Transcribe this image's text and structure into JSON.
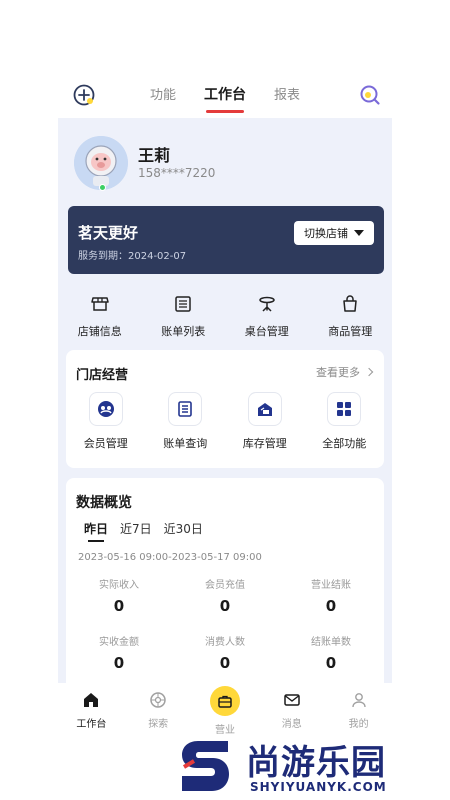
{
  "header": {
    "tabs": [
      {
        "label": "功能"
      },
      {
        "label": "工作台"
      },
      {
        "label": "报表"
      }
    ],
    "active_tab": "工作台",
    "left_icon": "add-circle-icon",
    "right_icon": "scan-icon"
  },
  "profile": {
    "name": "王莉",
    "phone": "158****7220",
    "status_color": "#3ccf63"
  },
  "store": {
    "name": "茗天更好",
    "expire": "服务到期：2024-02-07",
    "switch_label": "切换店铺"
  },
  "quick_actions": [
    {
      "label": "店铺信息",
      "icon": "store-icon"
    },
    {
      "label": "账单列表",
      "icon": "bill-list-icon"
    },
    {
      "label": "桌台管理",
      "icon": "table-icon"
    },
    {
      "label": "商品管理",
      "icon": "shopping-bag-icon"
    }
  ],
  "operations": {
    "title": "门店经营",
    "more_label": "查看更多",
    "items": [
      {
        "label": "会员管理",
        "icon": "member-icon"
      },
      {
        "label": "账单查询",
        "icon": "bill-query-icon"
      },
      {
        "label": "库存管理",
        "icon": "inventory-icon"
      },
      {
        "label": "全部功能",
        "icon": "grid-icon"
      }
    ]
  },
  "overview": {
    "title": "数据概览",
    "ranges": [
      {
        "label": "昨日"
      },
      {
        "label": "近7日"
      },
      {
        "label": "近30日"
      }
    ],
    "active_range": "昨日",
    "date_range": "2023-05-16 09:00-2023-05-17 09:00",
    "stats": [
      {
        "label": "实际收入",
        "value": "0"
      },
      {
        "label": "会员充值",
        "value": "0"
      },
      {
        "label": "营业结账",
        "value": "0"
      },
      {
        "label": "实收金额",
        "value": "0"
      },
      {
        "label": "消费人数",
        "value": "0"
      },
      {
        "label": "结账单数",
        "value": "0"
      }
    ]
  },
  "bottom_nav": [
    {
      "label": "工作台",
      "icon": "home-icon"
    },
    {
      "label": "探索",
      "icon": "compass-icon"
    },
    {
      "label": "营业",
      "icon": "briefcase-icon"
    },
    {
      "label": "消息",
      "icon": "mail-icon"
    },
    {
      "label": "我的",
      "icon": "user-icon"
    }
  ],
  "watermark": {
    "text": "尚游乐园",
    "sub": "SHYIYUANYK.COM"
  },
  "colors": {
    "accent_red": "#e43b3b",
    "store_card": "#2e3a5c",
    "yellow": "#ffd83a",
    "brand_blue": "#1e2b78"
  }
}
